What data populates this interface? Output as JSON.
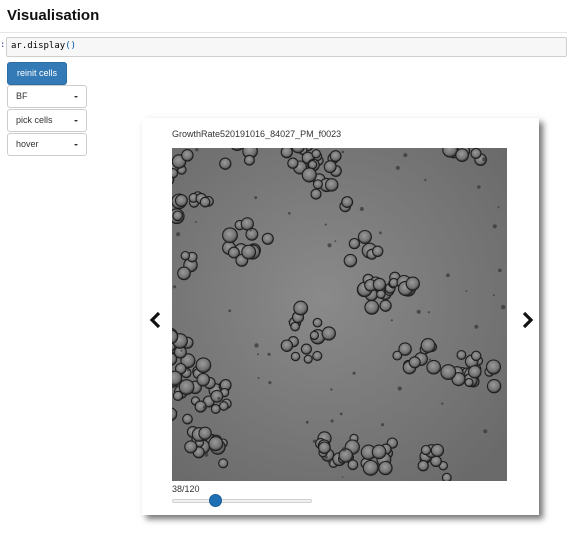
{
  "page": {
    "heading": "Visualisation",
    "cell_prompt": ":",
    "code": {
      "name": "ar.display",
      "parens": "()"
    }
  },
  "controls": {
    "reinit_label": "reinit cells",
    "channel_select": {
      "selected": "BF"
    },
    "mode_select": {
      "selected": "pick cells"
    },
    "hover_select": {
      "selected": "hover"
    }
  },
  "viewer": {
    "title": "GrowthRate520191016_84027_PM_f0023",
    "image_icon": "yeast-micrograph-image",
    "prev_icon": "chevron-left-icon",
    "next_icon": "chevron-right-icon",
    "frame_counter": "38/120",
    "frame_current": 38,
    "frame_total": 120
  },
  "colors": {
    "primary_button": "#337ab7",
    "slider_thumb": "#1f6fb3"
  }
}
